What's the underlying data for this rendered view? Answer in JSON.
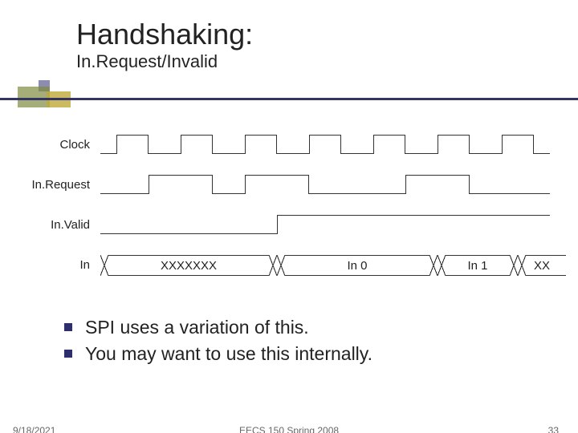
{
  "title": "Handshaking:",
  "subtitle": "In.Request/Invalid",
  "signals": {
    "clock_label": "Clock",
    "request_label": "In.Request",
    "valid_label": "In.Valid",
    "in_label": "In",
    "bus": {
      "seg0": "XXXXXXX",
      "seg1": "In 0",
      "seg2": "In 1",
      "seg3": "XX"
    }
  },
  "bullets": {
    "b0": "SPI uses a variation of this.",
    "b1": "You may want to use this internally."
  },
  "footer": {
    "date": "9/18/2021",
    "course": "EECS 150 Spring 2008",
    "page": "33"
  }
}
